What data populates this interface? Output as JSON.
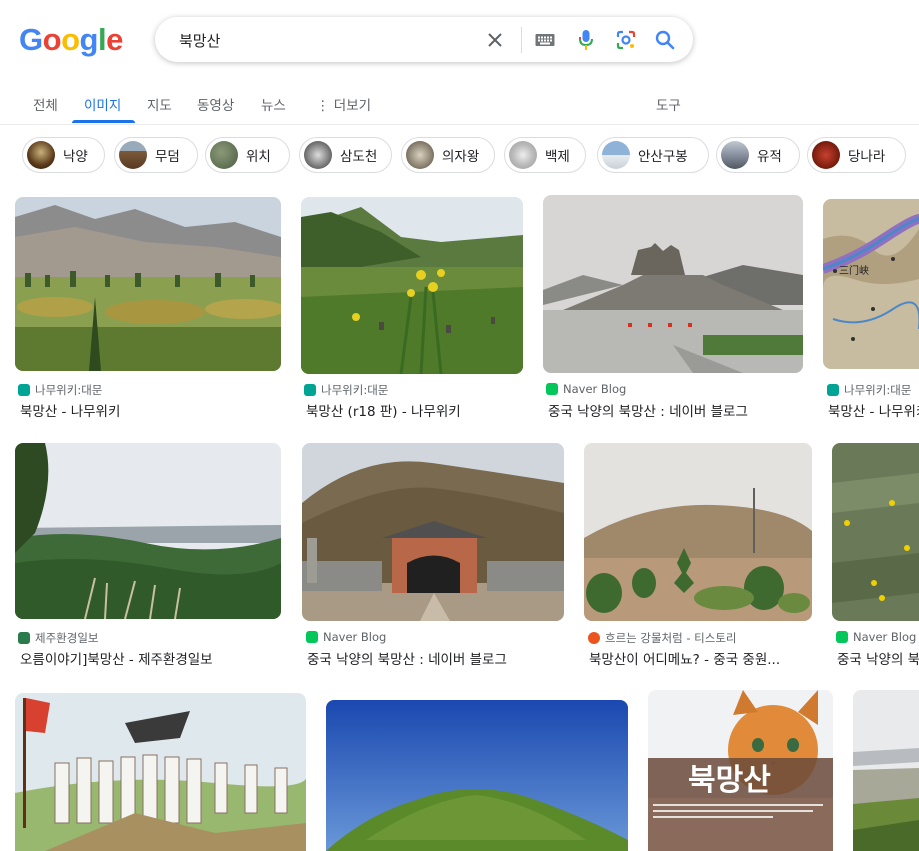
{
  "logo": {
    "letters": [
      "G",
      "o",
      "o",
      "g",
      "l",
      "e"
    ],
    "colors": [
      "#4285f4",
      "#ea4335",
      "#fbbc05",
      "#4285f4",
      "#34a853",
      "#ea4335"
    ]
  },
  "search": {
    "query": "북망산"
  },
  "icons": {
    "clear": "close-icon",
    "keyboard": "keyboard-icon",
    "mic": "mic-icon",
    "lens": "camera-lens-icon",
    "search": "search-icon"
  },
  "tabs": [
    {
      "label": "전체"
    },
    {
      "label": "이미지"
    },
    {
      "label": "지도"
    },
    {
      "label": "동영상"
    },
    {
      "label": "뉴스"
    },
    {
      "label": "더보기"
    }
  ],
  "more_prefix": "⋮",
  "tools_label": "도구",
  "chips": [
    "낙양",
    "무덤",
    "위치",
    "삼도천",
    "의자왕",
    "백제",
    "안산구봉",
    "유적",
    "당나라"
  ],
  "results": [
    {
      "source": "나무위키:대문",
      "title": "북망산 - 나무위키"
    },
    {
      "source": "나무위키:대문",
      "title": "북망산 (r18 판) - 나무위키"
    },
    {
      "source": "Naver Blog",
      "title": "중국 낙양의 북망산 : 네이버 블로그"
    },
    {
      "source": "나무위키:대문",
      "title": "북망산 - 나무위키"
    },
    {
      "source": "제주환경일보",
      "title": "오름이야기]북망산 - 제주환경일보"
    },
    {
      "source": "Naver Blog",
      "title": "중국 낙양의 북망산 : 네이버 블로그"
    },
    {
      "source": "흐르는 강물처럼 - 티스토리",
      "title": "북망산이 어디메뇨? - 중국 중원..."
    },
    {
      "source": "Naver Blog",
      "title": "중국 낙양의 북"
    }
  ],
  "thumb_text": {
    "cat_title": "북망산",
    "map_label": "三门峡"
  },
  "colors": {
    "accent": "#1a73e8",
    "namu": "#00a495",
    "naver": "#03c75a",
    "tistory": "#eb531f",
    "jeju": "#2b7a4b"
  }
}
